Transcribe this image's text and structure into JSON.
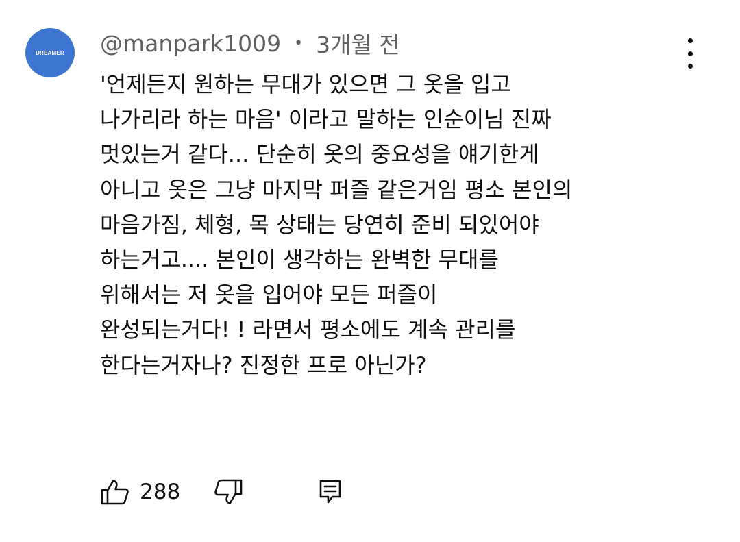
{
  "comment": {
    "avatar_text": "DREAMER",
    "author": "@manpark1009",
    "separator": "•",
    "time": "3개월 전",
    "lines": [
      "'언제든지 원하는 무대가 있으면 그 옷을 입고",
      "나가리라 하는 마음' 이라고 말하는 인순이님 진짜",
      "멋있는거 같다... 단순히 옷의 중요성을 얘기한게",
      "아니고 옷은 그냥 마지막 퍼즐 같은거임 평소 본인의",
      "마음가짐, 체형, 목 상태는 당연히 준비 되있어야",
      "하는거고.... 본인이 생각하는 완벽한 무대를",
      "위해서는 저 옷을 입어야 모든 퍼즐이",
      "완성되는거다! ! 라면서 평소에도 계속 관리를",
      "한다는거자나?  진정한 프로 아닌가?"
    ]
  },
  "actions": {
    "like_count": "288",
    "like_icon": "thumbs-up-icon",
    "dislike_icon": "thumbs-down-icon",
    "reply_icon": "reply-comment-icon",
    "more_icon": "more-vertical-icon"
  },
  "colors": {
    "avatar_bg": "#3d74cf",
    "text": "#0f0f0f",
    "secondary_text": "#606060"
  }
}
